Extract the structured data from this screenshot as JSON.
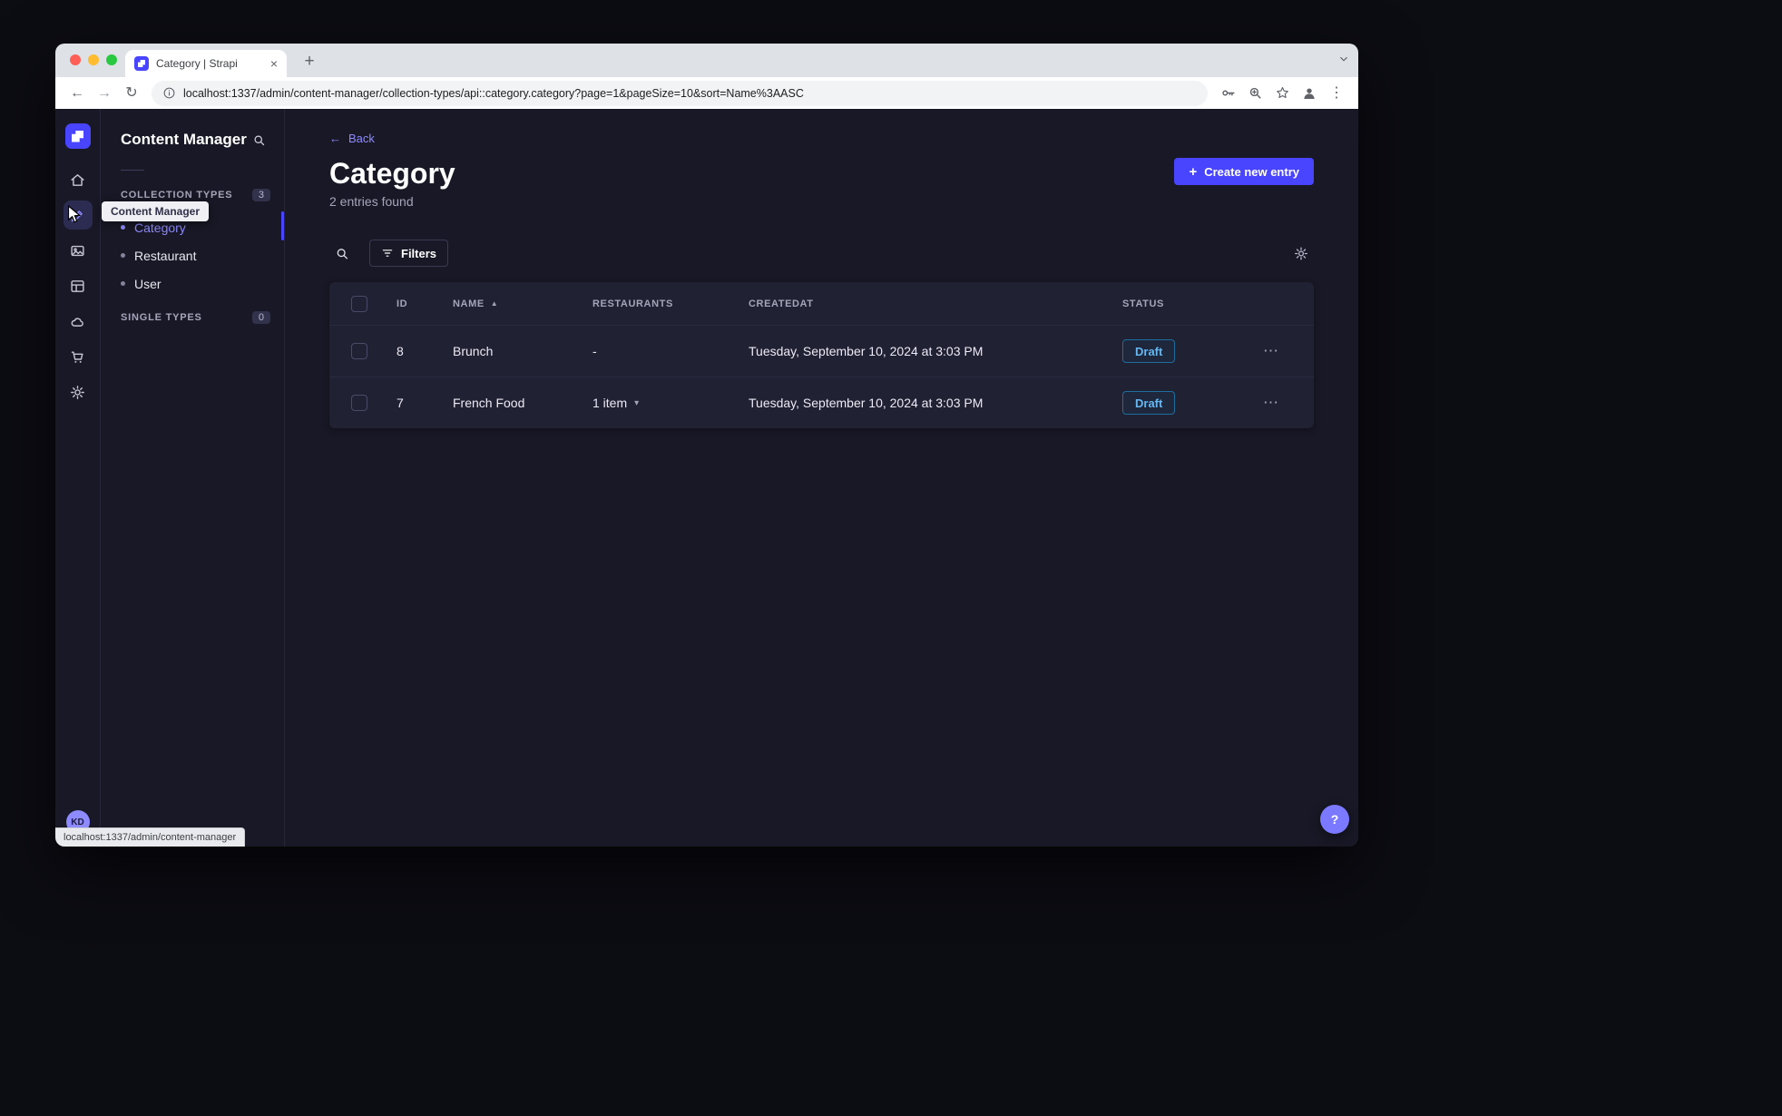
{
  "browser": {
    "tab": {
      "title": "Category | Strapi"
    },
    "url": "localhost:1337/admin/content-manager/collection-types/api::category.category?page=1&pageSize=10&sort=Name%3AASC",
    "status_bubble": "localhost:1337/admin/content-manager"
  },
  "rail": {
    "avatar_initials": "KD",
    "active_item": "content-manager"
  },
  "sidebar": {
    "title": "Content Manager",
    "sections": {
      "collection": {
        "label": "Collection Types",
        "count": "3"
      },
      "single": {
        "label": "Single Types",
        "count": "0"
      }
    },
    "items": [
      {
        "label": "Category",
        "active": true
      },
      {
        "label": "Restaurant",
        "active": false
      },
      {
        "label": "User",
        "active": false
      }
    ]
  },
  "tooltip": {
    "text": "Content Manager"
  },
  "main": {
    "back": "Back",
    "title": "Category",
    "subtitle": "2 entries found",
    "create_button": "Create new entry",
    "filters": "Filters"
  },
  "table": {
    "headers": {
      "id": "ID",
      "name": "NAME",
      "restaurants": "RESTAURANTS",
      "createdat": "CREATEDAT",
      "status": "STATUS"
    },
    "rows": [
      {
        "id": "8",
        "name": "Brunch",
        "restaurants": "-",
        "createdat": "Tuesday, September 10, 2024 at 3:03 PM",
        "status": "Draft"
      },
      {
        "id": "7",
        "name": "French Food",
        "restaurants": "1 item",
        "createdat": "Tuesday, September 10, 2024 at 3:03 PM",
        "status": "Draft"
      }
    ]
  },
  "help": {
    "label": "?"
  },
  "icons": {
    "plus": "+",
    "close": "×",
    "arrow_left": "←",
    "arrow_right": "→",
    "reload": "↻",
    "ellipsis": "⋯",
    "sort_asc": "▲",
    "chevron_down": "▾",
    "kebab": "⋮",
    "question": "?",
    "new_tab": "+"
  },
  "colors": {
    "primary": "#4945ff",
    "primary_light": "#8e8aff",
    "app_background": "#181826",
    "panel": "#212134",
    "draft_text": "#66b7f1",
    "text_subtle": "#a5a5ba",
    "traffic_red": "#ff5f57",
    "traffic_yellow": "#febc2e",
    "traffic_green": "#28c840"
  }
}
